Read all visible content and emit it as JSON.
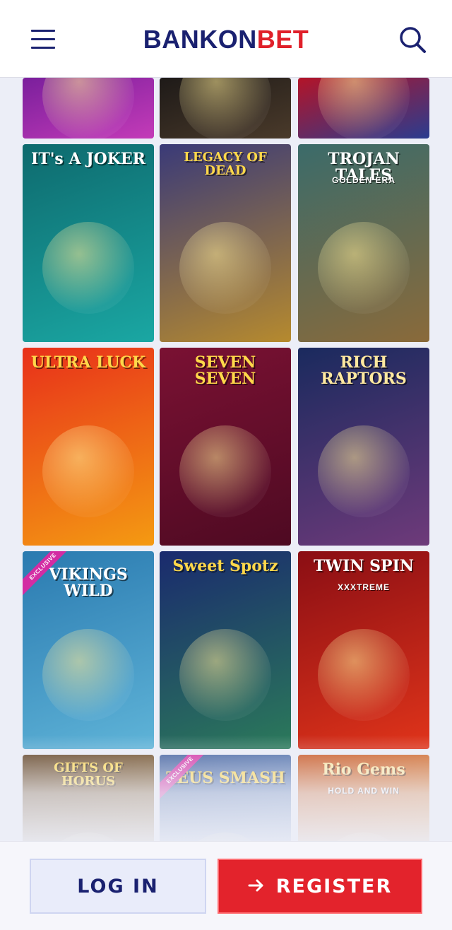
{
  "header": {
    "logo_part1": "BANKON",
    "logo_part2": "BET",
    "menu_icon": "hamburger-menu-icon",
    "search_icon": "search-icon",
    "colors": {
      "brand_navy": "#1a2170",
      "brand_red": "#e0202a"
    }
  },
  "games": [
    {
      "id": "partial-1",
      "title": "",
      "colors": [
        "#7a1f9c",
        "#c43bb8"
      ]
    },
    {
      "id": "partial-2",
      "title": "",
      "colors": [
        "#1e1a18",
        "#4a3a2a"
      ]
    },
    {
      "id": "partial-3",
      "title": "",
      "colors": [
        "#b31428",
        "#2a3c8f"
      ]
    },
    {
      "id": "its-a-joker",
      "title": "IT's A JOKER",
      "colors": [
        "#0e6a6e",
        "#1aa7a3"
      ]
    },
    {
      "id": "legacy-of-dead",
      "title": "LEGACY OF DEAD",
      "colors": [
        "#3a3a78",
        "#b68a2e"
      ]
    },
    {
      "id": "trojan-tales",
      "title": "TROJAN TALES",
      "subtitle": "GOLDEN ERA",
      "colors": [
        "#3b6b6a",
        "#8a6a3a"
      ]
    },
    {
      "id": "ultra-luck",
      "title": "ULTRA LUCK",
      "colors": [
        "#e8301a",
        "#f49a12"
      ]
    },
    {
      "id": "seven-seven",
      "title": "SEVEN SEVEN",
      "colors": [
        "#7a1133",
        "#4e0a22"
      ]
    },
    {
      "id": "rich-raptors",
      "title": "RICH RAPTORS",
      "colors": [
        "#1a2a5e",
        "#6e3a7a"
      ]
    },
    {
      "id": "vikings-wild",
      "title": "VIKINGS WILD",
      "badge": "EXCLUSIVE",
      "colors": [
        "#2a7ab0",
        "#5fb4d8"
      ]
    },
    {
      "id": "sweet-spotz",
      "title": "Sweet Spotz",
      "colors": [
        "#1a2a6e",
        "#2b7a5a"
      ]
    },
    {
      "id": "twin-spin-xxxtreme",
      "title": "TWIN SPIN",
      "subtitle": "XXXTREME",
      "colors": [
        "#8a0e14",
        "#e0341a"
      ]
    },
    {
      "id": "gifts-of-horus",
      "title": "GIFTS OF HORUS",
      "colors": [
        "#5a3a1a",
        "#b88a3a"
      ]
    },
    {
      "id": "zeus-smash",
      "title": "ZEUS SMASH",
      "badge": "EXCLUSIVE",
      "colors": [
        "#3a5a9a",
        "#8aaedc"
      ]
    },
    {
      "id": "rio-gems",
      "title": "Rio Gems",
      "subtitle": "HOLD AND WIN",
      "colors": [
        "#c8501a",
        "#f0b03a"
      ]
    }
  ],
  "footer": {
    "login_label": "LOG IN",
    "register_label": "REGISTER",
    "register_icon": "arrow-right-icon"
  }
}
